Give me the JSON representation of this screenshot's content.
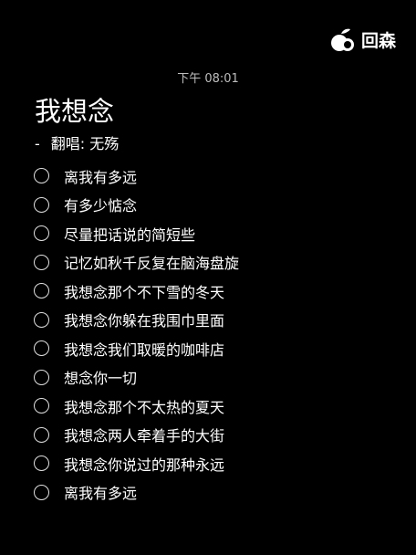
{
  "watermark": {
    "text": "回森"
  },
  "header": {
    "time": "下午 08:01"
  },
  "note": {
    "title": "我想念",
    "subtitle_dash": "-",
    "subtitle": "翻唱: 无殇"
  },
  "items": [
    "离我有多远",
    "有多少惦念",
    "尽量把话说的简短些",
    "记忆如秋千反复在脑海盘旋",
    "我想念那个不下雪的冬天",
    "我想念你躲在我围巾里面",
    "我想念我们取暖的咖啡店",
    "想念你一切",
    "我想念那个不太热的夏天",
    "我想念两人牵着手的大街",
    "我想念你说过的那种永远",
    "离我有多远"
  ]
}
